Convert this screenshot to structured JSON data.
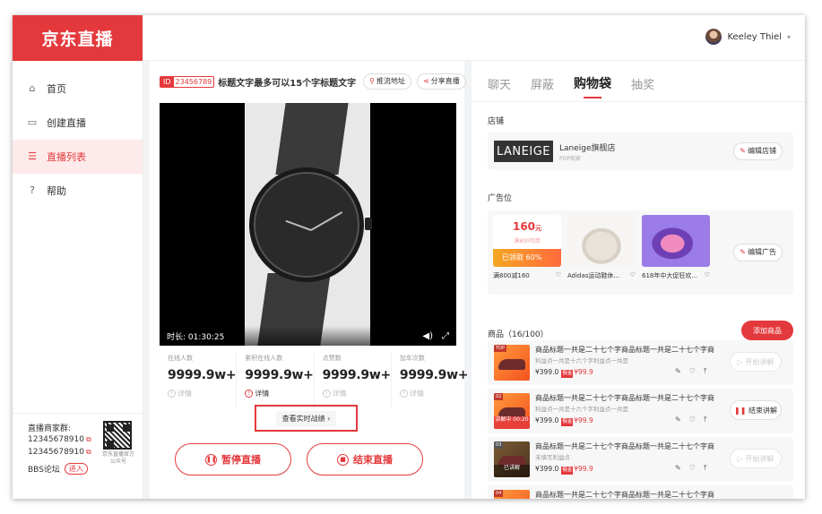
{
  "app": {
    "logo_text": "京东直播",
    "brand_color": "#e4393c"
  },
  "sidebar": {
    "items": [
      {
        "label": "首页",
        "icon": "home-icon",
        "active": false
      },
      {
        "label": "创建直播",
        "icon": "video-camera-icon",
        "active": false
      },
      {
        "label": "直播列表",
        "icon": "list-icon",
        "active": true
      },
      {
        "label": "帮助",
        "icon": "help-icon",
        "active": false
      }
    ],
    "footer": {
      "group_label": "直播商家群:",
      "group_numbers": [
        "12345678910",
        "12345678910"
      ],
      "bbs_label": "BBS论坛",
      "enter_label": "进入",
      "qr_caption": "京东直播官方公众号"
    }
  },
  "header": {
    "user_name": "Keeley Thiel"
  },
  "live": {
    "id_label": "ID",
    "id_value": "23456789",
    "title": "标题文字最多可以15个字标题文字",
    "push_url_label": "推流地址",
    "share_label": "分享直播",
    "duration_label": "时长:",
    "duration_value": "01:30:25",
    "stats": [
      {
        "label": "在线人数",
        "value": "9999.9w+",
        "detail": "详情",
        "detail_active": false
      },
      {
        "label": "累积在线人数",
        "value": "9999.9w+",
        "detail": "详情",
        "detail_active": true
      },
      {
        "label": "点赞数",
        "value": "9999.9w+",
        "detail": "详情",
        "detail_active": false
      },
      {
        "label": "加车次数",
        "value": "9999.9w+",
        "detail": "详情",
        "detail_active": false
      }
    ],
    "realtime_label": "查看实时战绩",
    "pause_label": "暂停直播",
    "end_label": "结束直播"
  },
  "right": {
    "tabs": [
      "聊天",
      "屏蔽",
      "购物袋",
      "抽奖"
    ],
    "active_tab": "购物袋",
    "shop_section": "店铺",
    "shop_logo_text": "LANEIGE",
    "shop_name": "Laneige旗舰店",
    "shop_sub": "POP商家",
    "edit_shop_label": "编辑店铺",
    "ad_section": "广告位",
    "coupon": {
      "amount": "160",
      "unit": "元",
      "condition": "满800可用",
      "got_label": "已领取 60%"
    },
    "ads": [
      {
        "caption": "满800减160"
      },
      {
        "caption": "Adidas运动鞋休..."
      },
      {
        "caption": "618年中大促狂欢..."
      }
    ],
    "edit_ad_label": "编辑广告",
    "goods_section": "商品（16/100）",
    "add_goods_label": "添加商品",
    "goods": [
      {
        "tag": "TOP",
        "title": "商品标题一共是二十七个字商品标题一共是二十七个字商品...",
        "sub": "利益点一共是十六个字利益点一共是",
        "price": "¥399.0",
        "badge": "俄金",
        "rprice": "¥99.9",
        "action": "开始讲解",
        "action_active": false,
        "live": ""
      },
      {
        "tag": "02",
        "title": "商品标题一共是二十七个字商品标题一共是二十七个字商品...",
        "sub": "利益点一共是十六个字利益点一共是",
        "price": "¥399.0",
        "badge": "俄金",
        "rprice": "¥99.9",
        "action": "结束讲解",
        "action_active": true,
        "live": "讲解中 00:20"
      },
      {
        "tag": "03",
        "title": "商品标题一共是二十七个字商品标题一共是二十七个字商品...",
        "sub": "未填写利益点",
        "price": "¥399.0",
        "badge": "俄金",
        "rprice": "¥99.9",
        "action": "开始讲解",
        "action_active": false,
        "live": "已讲解"
      },
      {
        "tag": "04",
        "title": "商品标题一共是二十七个字商品标题一共是二十七个字商品...",
        "sub": "",
        "price": "",
        "badge": "",
        "rprice": "",
        "action": "",
        "action_active": false,
        "live": ""
      }
    ]
  }
}
